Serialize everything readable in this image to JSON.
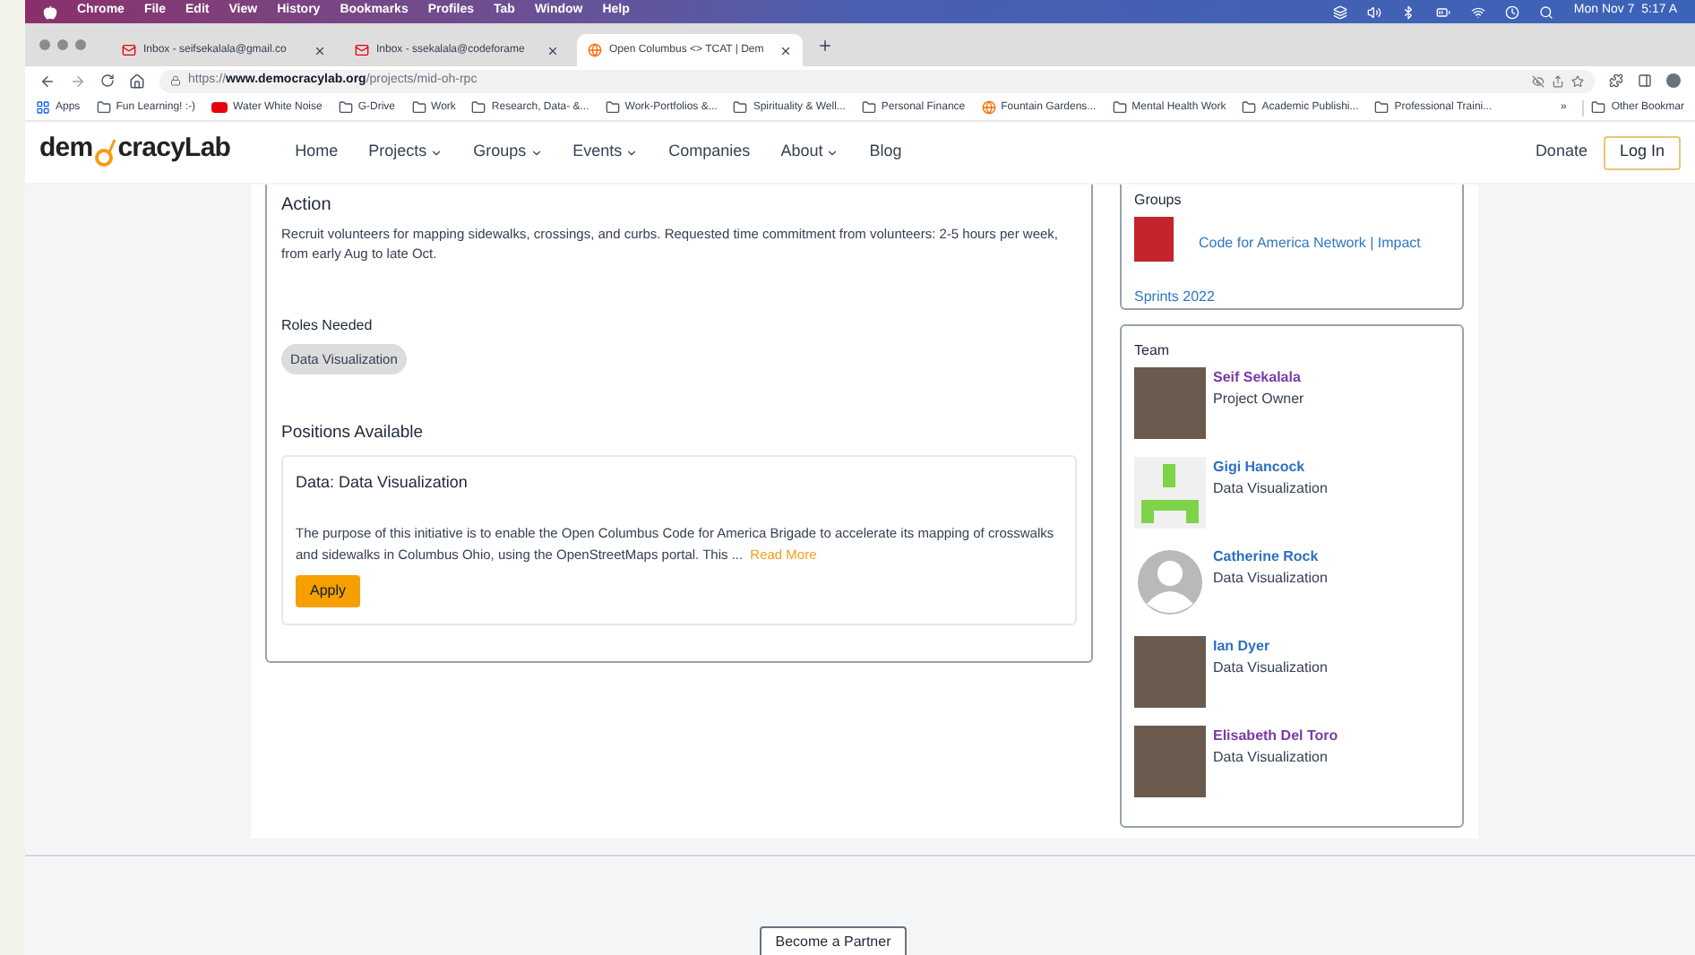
{
  "menu_bar": {
    "items": [
      "Chrome",
      "File",
      "Edit",
      "View",
      "History",
      "Bookmarks",
      "Profiles",
      "Tab",
      "Window",
      "Help"
    ],
    "clock": "Mon Nov 7  5:17 A"
  },
  "browser_tabs": [
    {
      "label": "Inbox - seifsekalala@gmail.co",
      "kind": "mail",
      "selected": false
    },
    {
      "label": "Inbox - ssekalala@codeforame",
      "kind": "mail",
      "selected": false
    },
    {
      "label": "Open Columbus <> TCAT | Dem",
      "kind": "site",
      "selected": true
    }
  ],
  "address_bar": {
    "url": "https://**www.democracylab.org**/projects/mid-oh-rpc"
  },
  "bookmarks": [
    {
      "label": "Apps",
      "kind": "apps"
    },
    {
      "label": "Fun Learning! :-)",
      "kind": "folder"
    },
    {
      "label": "Water White Noise",
      "kind": "video"
    },
    {
      "label": "G-Drive",
      "kind": "folder"
    },
    {
      "label": "Work",
      "kind": "folder"
    },
    {
      "label": "Research, Data- &...",
      "kind": "folder"
    },
    {
      "label": "Work-Portfolios &...",
      "kind": "folder"
    },
    {
      "label": "Spirituality & Well...",
      "kind": "folder"
    },
    {
      "label": "Personal Finance",
      "kind": "folder"
    },
    {
      "label": "Fountain Gardens...",
      "kind": "site"
    },
    {
      "label": "Mental Health Work",
      "kind": "folder"
    },
    {
      "label": "Academic Publishi...",
      "kind": "folder"
    },
    {
      "label": "Professional Traini...",
      "kind": "folder"
    }
  ],
  "bookmarks_more": "»",
  "other_bookmarks": "Other Bookmar",
  "site_nav": {
    "logo_left": "dem",
    "logo_right": "cracyLab",
    "items": [
      {
        "label": "Home",
        "has_menu": false
      },
      {
        "label": "Projects",
        "has_menu": true
      },
      {
        "label": "Groups",
        "has_menu": true
      },
      {
        "label": "Events",
        "has_menu": true
      },
      {
        "label": "Companies",
        "has_menu": false
      },
      {
        "label": "About",
        "has_menu": true
      },
      {
        "label": "Blog",
        "has_menu": false
      }
    ],
    "donate": "Donate",
    "login": "Log In"
  },
  "action": {
    "heading": "Action",
    "text": "Recruit volunteers for mapping sidewalks, crossings, and curbs. Requested time commitment from volunteers: 2-5 hours per week, from early Aug to late Oct."
  },
  "roles": {
    "heading": "Roles Needed",
    "items": [
      "Data Visualization"
    ]
  },
  "positions": {
    "heading": "Positions Available",
    "items": [
      {
        "title": "Data: Data Visualization",
        "text": "The purpose of this initiative is to enable the Open Columbus Code for America Brigade to accelerate its mapping of crosswalks and sidewalks in Columbus Ohio, using the OpenStreetMaps portal. This ...",
        "read_more": "Read More",
        "apply": "Apply"
      }
    ]
  },
  "groups": {
    "heading": "Groups",
    "items": [
      "Code for America Network | Impact Sprints 2022"
    ]
  },
  "team": {
    "heading": "Team",
    "members": [
      {
        "name": "Seif Sekalala",
        "role": "Project Owner",
        "kind": "photo",
        "visited": true
      },
      {
        "name": "Gigi Hancock",
        "role": "Data Visualization",
        "kind": "identicon",
        "visited": false
      },
      {
        "name": "Catherine Rock",
        "role": "Data Visualization",
        "kind": "silhouette",
        "visited": false
      },
      {
        "name": "Ian Dyer",
        "role": "Data Visualization",
        "kind": "photo",
        "visited": false
      },
      {
        "name": "Elisabeth Del Toro",
        "role": "Data Visualization",
        "kind": "photo",
        "visited": true
      }
    ]
  },
  "footer": {
    "button": "Become a Partner"
  }
}
